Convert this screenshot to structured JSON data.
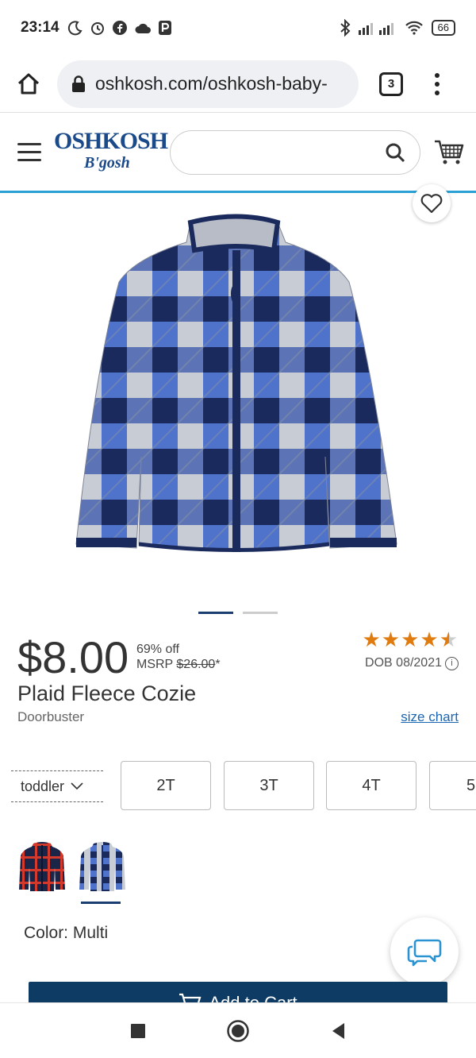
{
  "status_bar": {
    "time": "23:14",
    "battery": "66",
    "icons": [
      "moon-icon",
      "alarm-icon",
      "facebook-icon",
      "cloud-icon",
      "parking-icon",
      "bluetooth-icon",
      "signal-icon",
      "wifi-icon",
      "battery-icon"
    ]
  },
  "browser": {
    "url": "oshkosh.com/oshkosh-baby-",
    "tab_count": "3"
  },
  "header": {
    "logo_main": "OSHKOSH",
    "logo_sub": "B'gosh",
    "search_placeholder": ""
  },
  "product": {
    "price": "$8.00",
    "discount": "69% off",
    "msrp_label": "MSRP",
    "msrp_value": "$26.00",
    "msrp_suffix": "*",
    "rating_stars": 4.5,
    "rating_display": "★★★★★",
    "dob": "DOB 08/2021",
    "title": "Plaid Fleece Cozie",
    "subtitle": "Doorbuster",
    "size_chart": "size chart",
    "size_type": "toddler",
    "sizes": [
      "2T",
      "3T",
      "4T",
      "5"
    ],
    "color_label": "Color: Multi"
  },
  "colors": {
    "accent_blue": "#2aa0d4",
    "navy": "#0e3b63",
    "star_orange": "#e07b10",
    "link_blue": "#1a66b3"
  },
  "actions": {
    "add_to_cart": "Add to Cart"
  }
}
